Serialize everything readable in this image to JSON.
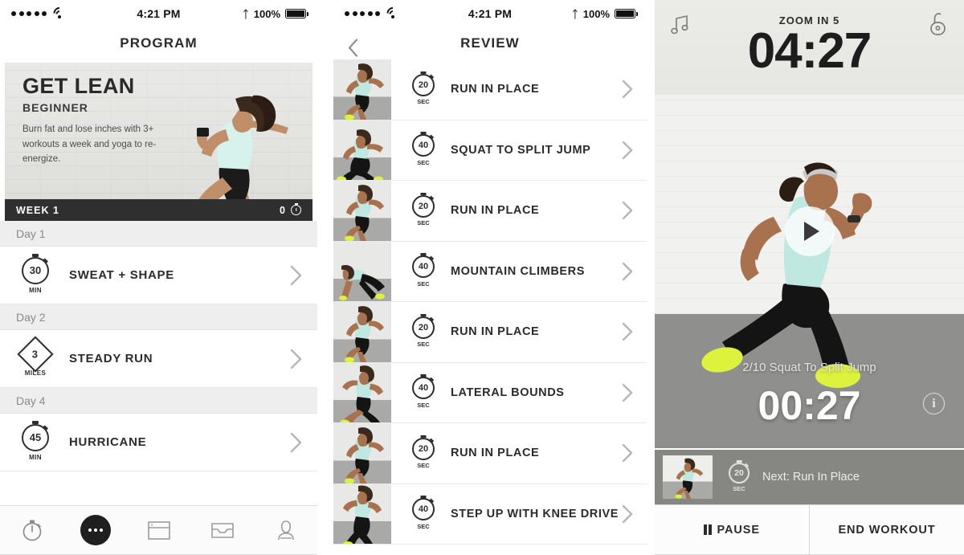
{
  "status_bar": {
    "time": "4:21 PM",
    "battery_pct": "100%",
    "signal_dots": 5,
    "wifi_icon": "wifi-icon",
    "bluetooth_icon": "bluetooth-icon",
    "battery_icon": "battery-full-icon"
  },
  "program_screen": {
    "nav_title": "PROGRAM",
    "hero": {
      "title": "GET LEAN",
      "level": "BEGINNER",
      "description": "Burn fat and lose inches with 3+ workouts a week and yoga to re-energize.",
      "week_label": "WEEK 1",
      "week_count": "0",
      "week_icon": "stopwatch-icon"
    },
    "days": [
      {
        "day_label": "Day 1",
        "workout": {
          "name": "SWEAT + SHAPE",
          "value": "30",
          "unit": "MIN",
          "badge_shape": "circle",
          "badge_icon": "stopwatch-icon"
        }
      },
      {
        "day_label": "Day 2",
        "workout": {
          "name": "STEADY RUN",
          "value": "3",
          "unit": "MILES",
          "badge_shape": "diamond",
          "badge_icon": "distance-icon"
        }
      },
      {
        "day_label": "Day 4",
        "workout": {
          "name": "HURRICANE",
          "value": "45",
          "unit": "MIN",
          "badge_shape": "circle",
          "badge_icon": "stopwatch-icon"
        }
      }
    ],
    "tabs": [
      {
        "name": "tab-timer",
        "icon": "stopwatch-icon",
        "active": false
      },
      {
        "name": "tab-programs",
        "icon": "dots-circle-icon",
        "active": true
      },
      {
        "name": "tab-library",
        "icon": "card-icon",
        "active": false
      },
      {
        "name": "tab-inbox",
        "icon": "inbox-icon",
        "active": false
      },
      {
        "name": "tab-profile",
        "icon": "person-icon",
        "active": false
      }
    ]
  },
  "review_screen": {
    "nav_title": "REVIEW",
    "back_icon": "chevron-left-icon",
    "exercises": [
      {
        "name": "RUN IN PLACE",
        "value": "20",
        "unit": "SEC",
        "pose": "run"
      },
      {
        "name": "SQUAT TO SPLIT JUMP",
        "value": "40",
        "unit": "SEC",
        "pose": "lunge"
      },
      {
        "name": "RUN IN PLACE",
        "value": "20",
        "unit": "SEC",
        "pose": "run"
      },
      {
        "name": "MOUNTAIN CLIMBERS",
        "value": "40",
        "unit": "SEC",
        "pose": "plank"
      },
      {
        "name": "RUN IN PLACE",
        "value": "20",
        "unit": "SEC",
        "pose": "run"
      },
      {
        "name": "LATERAL BOUNDS",
        "value": "40",
        "unit": "SEC",
        "pose": "bound"
      },
      {
        "name": "RUN IN PLACE",
        "value": "20",
        "unit": "SEC",
        "pose": "run"
      },
      {
        "name": "STEP UP WITH KNEE DRIVE",
        "value": "40",
        "unit": "SEC",
        "pose": "knee"
      }
    ],
    "row_chevron_icon": "chevron-right-icon"
  },
  "player_screen": {
    "header_title": "ZOOM IN 5",
    "total_timer": "04:27",
    "music_icon": "music-note-icon",
    "lock_icon": "unlock-icon",
    "play_icon": "play-icon",
    "current_exercise": "2/10 Squat To Split Jump",
    "exercise_timer": "00:27",
    "info_icon": "info-icon",
    "info_glyph": "i",
    "next": {
      "label": "Next: Run In Place",
      "value": "20",
      "unit": "SEC",
      "badge_icon": "stopwatch-icon"
    },
    "buttons": [
      {
        "label": "PAUSE",
        "icon": "pause-icon"
      },
      {
        "label": "END WORKOUT",
        "icon": ""
      }
    ]
  },
  "colors": {
    "dark": "#2f2f2f",
    "text": "#2b2b2b",
    "muted": "#8a8a8a",
    "row_divider": "#eaeaea",
    "day_header_bg": "#eeeeee",
    "overlay_gray": "#868683",
    "mint": "#bfe8e0",
    "neon": "#dcf23c"
  }
}
